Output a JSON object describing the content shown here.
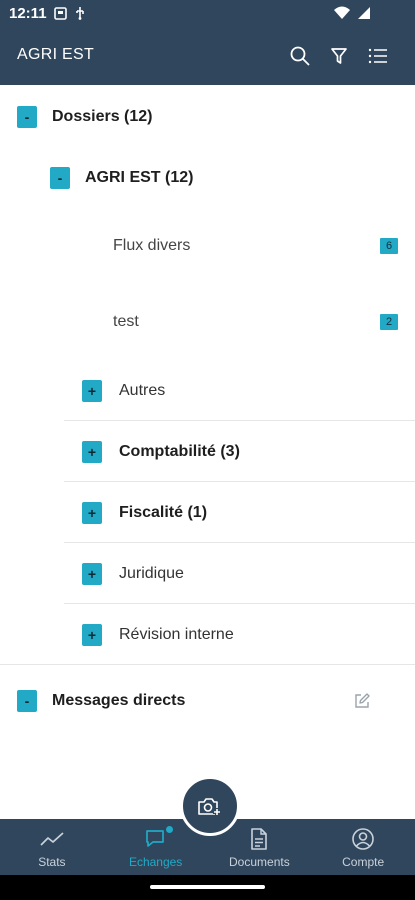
{
  "status_bar": {
    "time": "12:11"
  },
  "header": {
    "title": "AGRI EST",
    "actions": [
      "search-icon",
      "filter-icon",
      "list-view-icon"
    ]
  },
  "tree": {
    "root": {
      "toggle": "-",
      "label": "Dossiers (12)"
    },
    "folder": {
      "toggle": "-",
      "label": "AGRI EST (12)"
    },
    "leaves": [
      {
        "label": "Flux divers",
        "count": "6"
      },
      {
        "label": "test",
        "count": "2"
      }
    ],
    "subfolders": [
      {
        "toggle": "+",
        "label": "Autres"
      },
      {
        "toggle": "+",
        "label": "Comptabilité (3)"
      },
      {
        "toggle": "+",
        "label": "Fiscalité (1)"
      },
      {
        "toggle": "+",
        "label": "Juridique"
      },
      {
        "toggle": "+",
        "label": "Révision interne"
      }
    ],
    "messages": {
      "toggle": "-",
      "label": "Messages directs"
    }
  },
  "bottom_nav": {
    "items": [
      {
        "label": "Stats",
        "icon": "stats-line-icon",
        "active": false
      },
      {
        "label": "Echanges",
        "icon": "chat-icon",
        "active": true
      },
      {
        "label": "Documents",
        "icon": "document-icon",
        "active": false
      },
      {
        "label": "Compte",
        "icon": "account-icon",
        "active": false
      }
    ]
  },
  "colors": {
    "header_bg": "#30465c",
    "accent": "#21a9c6",
    "divider": "#e6e6e6"
  }
}
